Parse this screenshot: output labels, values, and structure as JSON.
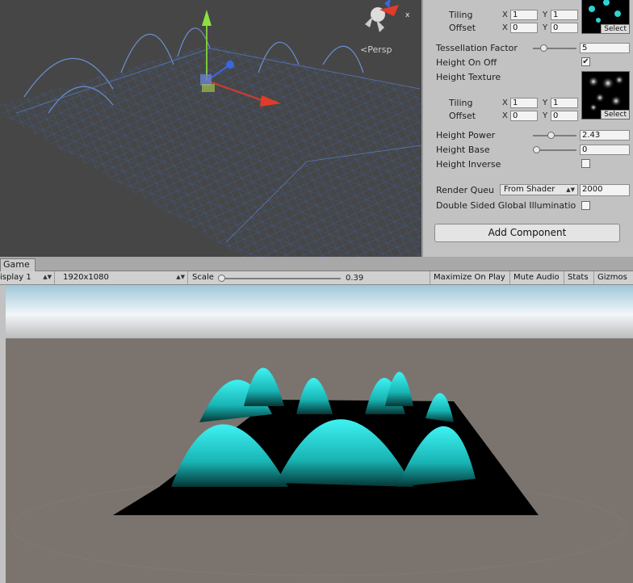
{
  "scene": {
    "persp_label": "<Persp",
    "gizmo_axis_label": "x"
  },
  "inspector": {
    "tiling_label": "Tiling",
    "offset_label": "Offset",
    "x_label": "X",
    "y_label": "Y",
    "tiling1": {
      "x": "1",
      "y": "1"
    },
    "offset1": {
      "x": "0",
      "y": "0"
    },
    "tess_label": "Tessellation Factor",
    "tess_value": "5",
    "tess_slider": 0.2,
    "height_on_off_label": "Height On Off",
    "height_on_off_checked": "✔",
    "height_texture_label": "Height Texture",
    "tiling2": {
      "x": "1",
      "y": "1"
    },
    "offset2": {
      "x": "0",
      "y": "0"
    },
    "select_label": "Select",
    "height_power_label": "Height Power",
    "height_power_value": "2.43",
    "height_power_slider": 0.4,
    "height_base_label": "Height Base",
    "height_base_value": "0",
    "height_base_slider": 0.0,
    "height_inverse_label": "Height Inverse",
    "render_queue_label": "Render Queu",
    "render_queue_option": "From Shader",
    "render_queue_value": "2000",
    "double_sided_label": "Double Sided Global Illuminatio",
    "add_component_label": "Add Component"
  },
  "game": {
    "tab_label": "Game",
    "display_label": "isplay 1",
    "resolution_label": "1920x1080",
    "scale_label": "Scale",
    "scale_value": "0.39",
    "scale_slider": 0.0,
    "maximize_label": "Maximize On Play",
    "mute_label": "Mute Audio",
    "stats_label": "Stats",
    "gizmos_label": "Gizmos"
  }
}
